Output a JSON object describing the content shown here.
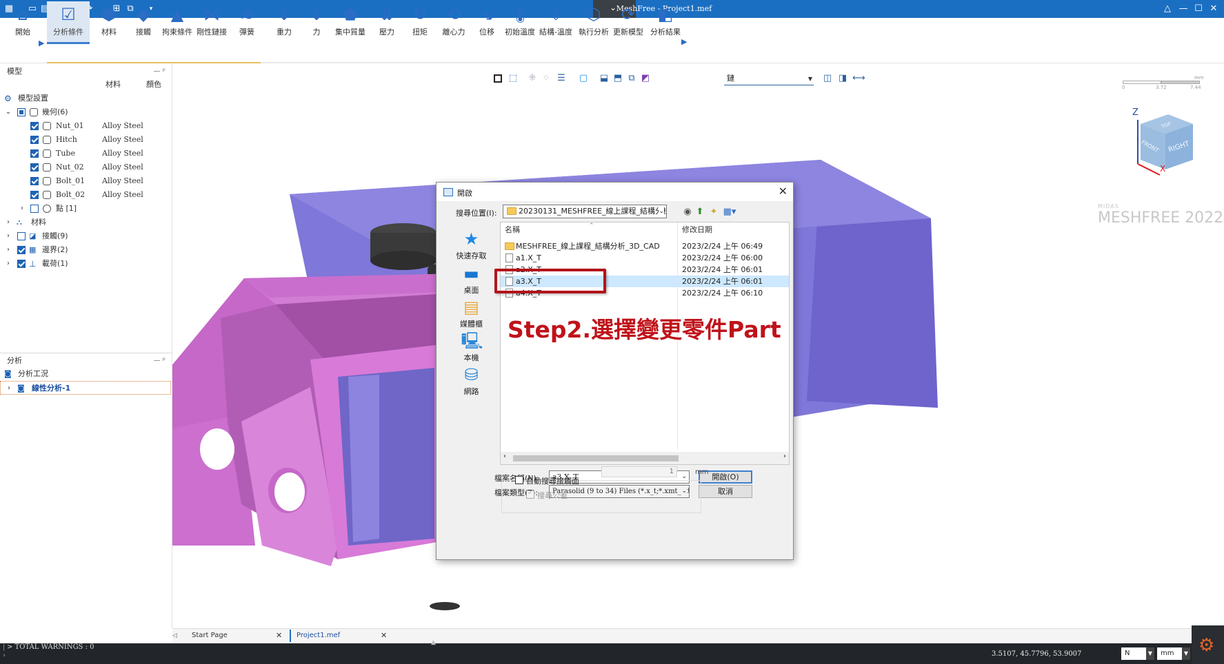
{
  "titlebar": {
    "title": "MeshFree - Project1.mef"
  },
  "ribbon": {
    "tabs": [
      {
        "label": "開始"
      },
      {
        "label": "分析條件"
      },
      {
        "label": "材料"
      },
      {
        "label": "接觸"
      },
      {
        "label": "拘束條件"
      },
      {
        "label": "剛性鏈接"
      },
      {
        "label": "彈簧"
      },
      {
        "label": "重力"
      },
      {
        "label": "力"
      },
      {
        "label": "集中質量"
      },
      {
        "label": "壓力"
      },
      {
        "label": "扭矩"
      },
      {
        "label": "離心力"
      },
      {
        "label": "位移"
      },
      {
        "label": "初始溫度"
      },
      {
        "label": "結構-溫度"
      },
      {
        "label": "執行分析"
      },
      {
        "label": "更新模型"
      },
      {
        "label": "分析結果"
      }
    ]
  },
  "model_panel": {
    "header": "模型",
    "col_material": "材料",
    "col_color": "顏色",
    "root": "模型設置",
    "geometry": "幾何(6)",
    "parts": [
      {
        "name": "Nut_01",
        "material": "Alloy Steel"
      },
      {
        "name": "Hitch",
        "material": "Alloy Steel"
      },
      {
        "name": "Tube",
        "material": "Alloy Steel"
      },
      {
        "name": "Nut_02",
        "material": "Alloy Steel"
      },
      {
        "name": "Bolt_01",
        "material": "Alloy Steel"
      },
      {
        "name": "Bolt_02",
        "material": "Alloy Steel"
      }
    ],
    "points": "點 [1]",
    "materials": "材料",
    "contacts": "接觸(9)",
    "boundaries": "邊界(2)",
    "loads": "載荷(1)"
  },
  "analysis_panel": {
    "header": "分析",
    "case_group": "分析工況",
    "case": "線性分析-1"
  },
  "viewport": {
    "view_select": "鏈",
    "brand_small": "MIDAS",
    "brand_big": "MESHFREE 2022",
    "scale_unit": "mm",
    "scale_ticks": [
      "0",
      "3.72",
      "7.44"
    ],
    "cube_front": "FRONT",
    "cube_right": "RIGHT",
    "cube_top": "TOP",
    "axis_z": "Z",
    "axis_x": "X"
  },
  "dialog": {
    "title": "開啟",
    "look_in_label": "搜尋位置(I):",
    "look_in_value": "20230131_MESHFREE_線上課程_結構分析",
    "places": [
      {
        "label": "快速存取"
      },
      {
        "label": "桌面"
      },
      {
        "label": "媒體櫃"
      },
      {
        "label": "本機"
      },
      {
        "label": "網路"
      }
    ],
    "col_name": "名稱",
    "col_date": "修改日期",
    "files": [
      {
        "name": "MESHFREE_線上課程_結構分析_3D_CAD",
        "date": "2023/2/24 上午 06:49"
      },
      {
        "name": "a1.X_T",
        "date": "2023/2/24 上午 06:00"
      },
      {
        "name": "a2.X_T",
        "date": "2023/2/24 上午 06:01"
      },
      {
        "name": "a3.X_T",
        "date": "2023/2/24 上午 06:01"
      },
      {
        "name": "a4.X_T",
        "date": "2023/2/24 上午 06:10"
      }
    ],
    "filename_label": "檔案名稱(N):",
    "filename_value": "a3.X_T",
    "filetype_label": "檔案類型(T):",
    "filetype_value": "Parasolid (9 to 34) Files (*.x_t;*.xmt_txt;*.x_b;",
    "open_button": "開啟(O)",
    "cancel_button": "取消",
    "auto_search_label": "自動搜尋接觸面",
    "tolerance_label": "搜尋公差",
    "tolerance_value": "1",
    "tolerance_unit": "mm"
  },
  "annotation": {
    "step_text": "Step2.選擇變更零件Part"
  },
  "doc_tabs": [
    {
      "label": "Start Page"
    },
    {
      "label": "Project1.mef"
    }
  ],
  "status": {
    "warnings": "> TOTAL WARNINGS : 0",
    "coords": "3.5107, 45.7796, 53.9007",
    "force_unit": "N",
    "length_unit": "mm"
  },
  "colors": {
    "titlebar": "#1b6fc2",
    "highlight": "#b3141b",
    "part_pink": "#d77ad6",
    "part_blue": "#7b72d6"
  }
}
